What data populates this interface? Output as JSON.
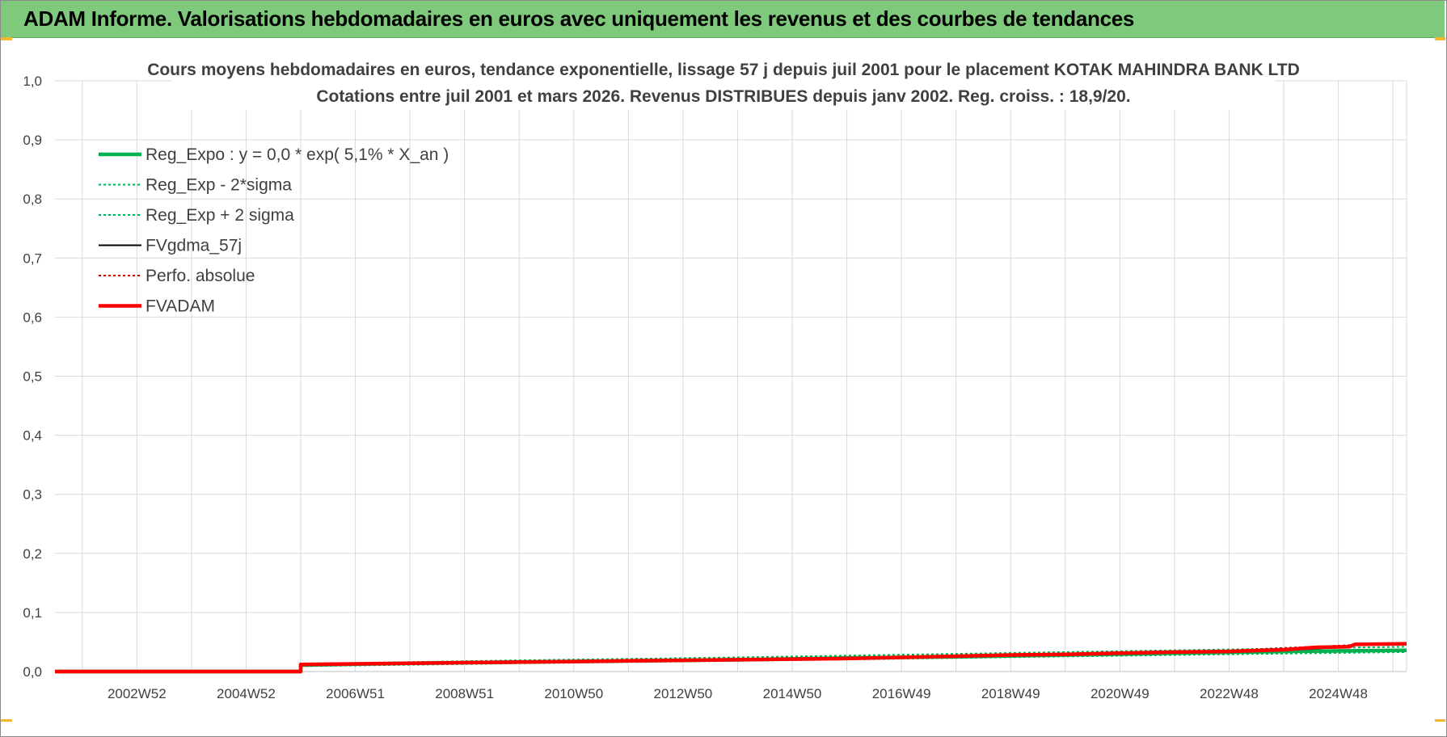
{
  "banner": {
    "title": "ADAM Informe. Valorisations hebdomadaires en euros avec uniquement les revenus et des courbes de tendances"
  },
  "colors": {
    "banner_bg": "#7ec97b",
    "reg_expo": "#00b050",
    "fvgdma": "#000000",
    "perfo": "#c00000",
    "fvadam": "#ff0000",
    "grid": "#d9d9d9",
    "accent_corner": "#f2b632"
  },
  "chart_data": {
    "type": "line",
    "title_line1": "Cours moyens hebdomadaires en euros, tendance exponentielle, lissage 57 j depuis juil 2001 pour le placement KOTAK MAHINDRA BANK LTD",
    "title_line2": "Cotations entre juil 2001 et mars 2026. Revenus DISTRIBUES depuis janv 2002. Reg. croiss. : 18,9/20.",
    "ylim": [
      0,
      1.0
    ],
    "y_ticks": [
      "0,0",
      "0,1",
      "0,2",
      "0,3",
      "0,4",
      "0,5",
      "0,6",
      "0,7",
      "0,8",
      "0,9",
      "1,0"
    ],
    "x_range": [
      2001.5,
      2026.25
    ],
    "x_ticks": [
      {
        "label": "2002W52",
        "x": 2003.0
      },
      {
        "label": "2004W52",
        "x": 2005.0
      },
      {
        "label": "2006W51",
        "x": 2007.0
      },
      {
        "label": "2008W51",
        "x": 2009.0
      },
      {
        "label": "2010W50",
        "x": 2011.0
      },
      {
        "label": "2012W50",
        "x": 2013.0
      },
      {
        "label": "2014W50",
        "x": 2015.0
      },
      {
        "label": "2016W49",
        "x": 2017.0
      },
      {
        "label": "2018W49",
        "x": 2019.0
      },
      {
        "label": "2020W49",
        "x": 2021.0
      },
      {
        "label": "2022W48",
        "x": 2023.0
      },
      {
        "label": "2024W48",
        "x": 2025.0
      }
    ],
    "grid": true,
    "legend_position": "top-left",
    "series": [
      {
        "name": "Reg_Expo : y = 0,0 * exp( 5,1% *  X_an )",
        "style": "solid-thick",
        "color": "#00b050",
        "points": [
          [
            2001.5,
            0.0
          ],
          [
            2006.0,
            0.0
          ],
          [
            2006.0,
            0.011
          ],
          [
            2008,
            0.014
          ],
          [
            2010,
            0.016
          ],
          [
            2012,
            0.018
          ],
          [
            2014,
            0.02
          ],
          [
            2016,
            0.023
          ],
          [
            2018,
            0.025
          ],
          [
            2020,
            0.028
          ],
          [
            2022,
            0.031
          ],
          [
            2024,
            0.034
          ],
          [
            2026.25,
            0.036
          ]
        ]
      },
      {
        "name": "Reg_Exp - 2*sigma",
        "style": "dotted",
        "color": "#00b050",
        "points": [
          [
            2006.0,
            0.009
          ],
          [
            2010,
            0.014
          ],
          [
            2014,
            0.018
          ],
          [
            2018,
            0.023
          ],
          [
            2022,
            0.028
          ],
          [
            2026.25,
            0.033
          ]
        ]
      },
      {
        "name": "Reg_Exp + 2 sigma",
        "style": "dotted",
        "color": "#00b050",
        "points": [
          [
            2006.0,
            0.013
          ],
          [
            2010,
            0.019
          ],
          [
            2014,
            0.024
          ],
          [
            2018,
            0.03
          ],
          [
            2022,
            0.036
          ],
          [
            2026.25,
            0.042
          ]
        ]
      },
      {
        "name": "FVgdma_57j",
        "style": "solid",
        "color": "#000000",
        "points": [
          [
            2001.5,
            0.0
          ],
          [
            2006.0,
            0.0
          ],
          [
            2006.0,
            0.012
          ],
          [
            2008,
            0.014
          ],
          [
            2012,
            0.017
          ],
          [
            2016,
            0.022
          ],
          [
            2020,
            0.029
          ],
          [
            2024,
            0.036
          ],
          [
            2025.0,
            0.041
          ],
          [
            2025.3,
            0.045
          ],
          [
            2026.25,
            0.046
          ]
        ]
      },
      {
        "name": "Perfo. absolue",
        "style": "dotted",
        "color": "#c00000",
        "points": [
          [
            2001.5,
            0.0
          ],
          [
            2006.0,
            0.0
          ],
          [
            2006.0,
            0.012
          ],
          [
            2010,
            0.016
          ],
          [
            2014,
            0.02
          ],
          [
            2018,
            0.026
          ],
          [
            2022,
            0.032
          ],
          [
            2025.3,
            0.045
          ],
          [
            2026.25,
            0.046
          ]
        ]
      },
      {
        "name": "FVADAM",
        "style": "solid-thick",
        "color": "#ff0000",
        "points": [
          [
            2001.5,
            0.0
          ],
          [
            2006.0,
            0.0
          ],
          [
            2006.0,
            0.012
          ],
          [
            2007,
            0.013
          ],
          [
            2008,
            0.014
          ],
          [
            2009,
            0.015
          ],
          [
            2010,
            0.016
          ],
          [
            2011,
            0.017
          ],
          [
            2012,
            0.018
          ],
          [
            2013,
            0.019
          ],
          [
            2014,
            0.02
          ],
          [
            2015,
            0.021
          ],
          [
            2016,
            0.022
          ],
          [
            2017,
            0.024
          ],
          [
            2018,
            0.026
          ],
          [
            2019,
            0.028
          ],
          [
            2020,
            0.029
          ],
          [
            2021,
            0.031
          ],
          [
            2022,
            0.033
          ],
          [
            2023,
            0.034
          ],
          [
            2024,
            0.037
          ],
          [
            2024.6,
            0.041
          ],
          [
            2025.2,
            0.042
          ],
          [
            2025.3,
            0.046
          ],
          [
            2026.25,
            0.047
          ]
        ]
      }
    ]
  }
}
